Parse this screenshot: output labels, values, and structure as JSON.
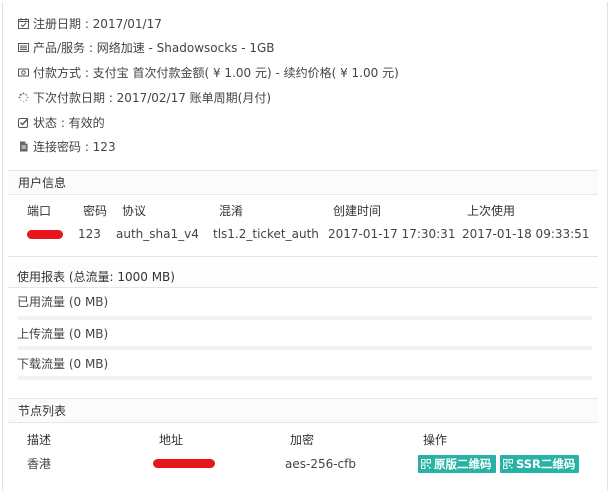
{
  "service_info": {
    "register_date": "注册日期 : 2017/01/17",
    "product": "产品/服务 : 网络加速 - Shadowsocks - 1GB",
    "payment": "付款方式 : 支付宝 首次付款金额( ¥ 1.00 元) - 续约价格( ¥ 1.00 元)",
    "next_due": "下次付款日期 : 2017/02/17 账单周期(月付)",
    "status": "状态 : 有效的",
    "password": "连接密码 : 123"
  },
  "user_info": {
    "title": "用户信息",
    "headers": [
      "端口",
      "密码",
      "协议",
      "混淆",
      "创建时间",
      "上次使用"
    ],
    "row": {
      "password": "123",
      "protocol": "auth_sha1_v4",
      "obfs": "tls1.2_ticket_auth",
      "created": "2017-01-17 17:30:31",
      "last_used": "2017-01-18 09:33:51"
    }
  },
  "usage": {
    "title": "使用报表 (总流量: 1000 MB)",
    "items": [
      {
        "label": "已用流量 (0 MB)",
        "percent": 0
      },
      {
        "label": "上传流量 (0 MB)",
        "percent": 0
      },
      {
        "label": "下载流量 (0 MB)",
        "percent": 0
      }
    ]
  },
  "nodes": {
    "title": "节点列表",
    "headers": [
      "描述",
      "地址",
      "加密",
      "操作"
    ],
    "row": {
      "desc": "香港",
      "cipher": "aes-256-cfb",
      "btn_original_qr": "原版二维码",
      "btn_ssr_qr": "SSR二维码"
    }
  },
  "icons": {
    "register_date": "calendar-check-icon",
    "product": "list-icon",
    "payment": "money-icon",
    "next_due": "spinner-icon",
    "status": "check-square-icon",
    "password": "file-icon",
    "qr": "qrcode-icon"
  },
  "colors": {
    "accent": "#26b3a5",
    "redaction": "#e8151d"
  }
}
